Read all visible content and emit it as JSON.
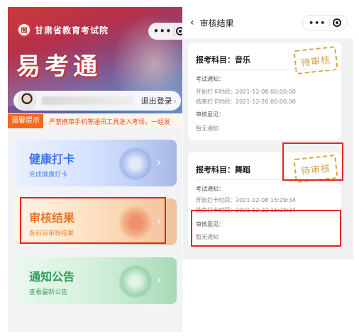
{
  "left": {
    "org_name": "甘肃省教育考试院",
    "logo_text": "囿",
    "app_title": "易考通",
    "logout_label": "退出登录",
    "notice_tag": "温馨提示",
    "notice_text": "严禁携带手机等通讯工具进入考场，一经发",
    "menu": [
      {
        "title": "健康打卡",
        "subtitle": "完成健康打卡"
      },
      {
        "title": "审核结果",
        "subtitle": "各科目审核结果"
      },
      {
        "title": "通知公告",
        "subtitle": "查看最新公告"
      }
    ]
  },
  "right": {
    "nav_title": "审核结果",
    "cards": [
      {
        "subject_label": "报考科目：",
        "subject": "音乐",
        "stamp": "待审核",
        "notice_label": "考试通知：",
        "start_time": "开始打卡时间：2021-12-08 00:00:00",
        "end_time": "结束打卡时间：2021-12-20 00:00:00",
        "opinion_label": "审核意见：",
        "opinion": "暂无通知"
      },
      {
        "subject_label": "报考科目：",
        "subject": "舞蹈",
        "stamp": "待审核",
        "notice_label": "考试通知：",
        "start_time": "开始打卡时间：2021-12-08 15:29:34",
        "end_time": "结束打卡时间：2021-12-22 15:29:34",
        "opinion_label": "审核意见：",
        "opinion": "暂无通知"
      }
    ]
  },
  "icons": {
    "menu_dots": "•••",
    "back": "‹",
    "chevron": "›"
  },
  "colors": {
    "accent_orange": "#f06a20",
    "health_blue": "#3b76f0",
    "audit_orange": "#e8782a",
    "notice_green": "#2f9b59",
    "stamp_gold": "#d9a24a",
    "highlight_red": "#e32424"
  }
}
